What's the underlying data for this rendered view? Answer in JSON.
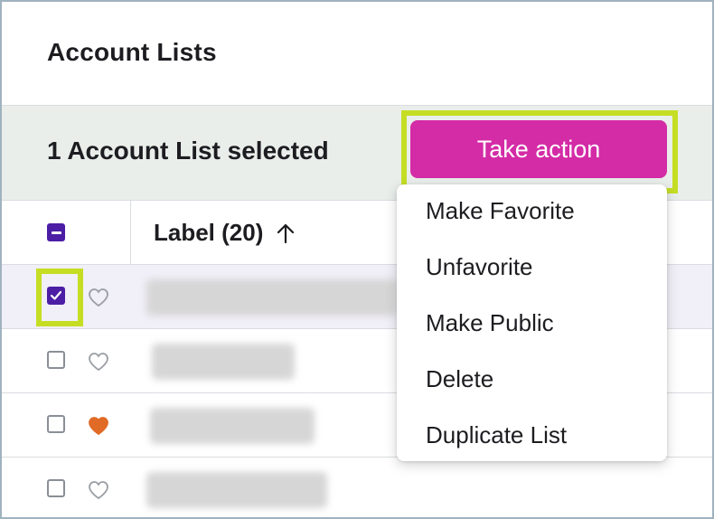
{
  "page": {
    "title": "Account Lists"
  },
  "selection": {
    "text": "1 Account List selected",
    "take_action_label": "Take action"
  },
  "table": {
    "select_all_state": "indeterminate",
    "label_header": "Label (20)",
    "sort_icon": "arrow-up-icon",
    "rows": [
      {
        "checked": true,
        "favorite": false
      },
      {
        "checked": false,
        "favorite": false
      },
      {
        "checked": false,
        "favorite": true
      },
      {
        "checked": false,
        "favorite": false
      }
    ]
  },
  "menu": {
    "items": [
      "Make Favorite",
      "Unfavorite",
      "Make Public",
      "Delete",
      "Duplicate List"
    ]
  },
  "colors": {
    "accent": "#d42ba6",
    "checkbox": "#4b1ea5",
    "highlight": "#c5de24",
    "favorite_heart": "#e06a26",
    "selection_bar": "#e9eeeb"
  }
}
